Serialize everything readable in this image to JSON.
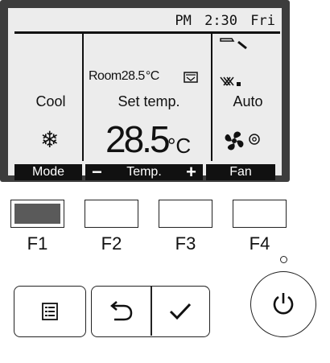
{
  "lcd": {
    "clock": {
      "ampm": "PM",
      "time": "2:30",
      "day": "Fri"
    },
    "mode": "Cool",
    "room_label": "Room",
    "room_temp": "28.5",
    "room_unit": "°C",
    "set_temp_label": "Set temp.",
    "set_temp_value": "28.5",
    "set_temp_unit": "°C",
    "fan_speed": "Auto"
  },
  "function_bar": {
    "mode": "Mode",
    "temp_minus": "−",
    "temp": "Temp.",
    "temp_plus": "+",
    "fan": "Fan"
  },
  "function_buttons": [
    {
      "label": "F1",
      "active": true
    },
    {
      "label": "F2",
      "active": false
    },
    {
      "label": "F3",
      "active": false
    },
    {
      "label": "F4",
      "active": false
    }
  ],
  "icons": {
    "mode_icon": "snowflake-icon",
    "filter_icon": "filter-icon",
    "vane_icon": "vane-icon",
    "louver_icon": "louver-icon",
    "fan_icon": "fan-icon",
    "menu_icon": "menu-icon",
    "back_icon": "return-icon",
    "ok_icon": "check-icon",
    "power_icon": "power-icon"
  },
  "colors": {
    "lcd_background": "#ececec",
    "bezel": "#3d3d3d",
    "active_button_fill": "#5a5a5a"
  }
}
